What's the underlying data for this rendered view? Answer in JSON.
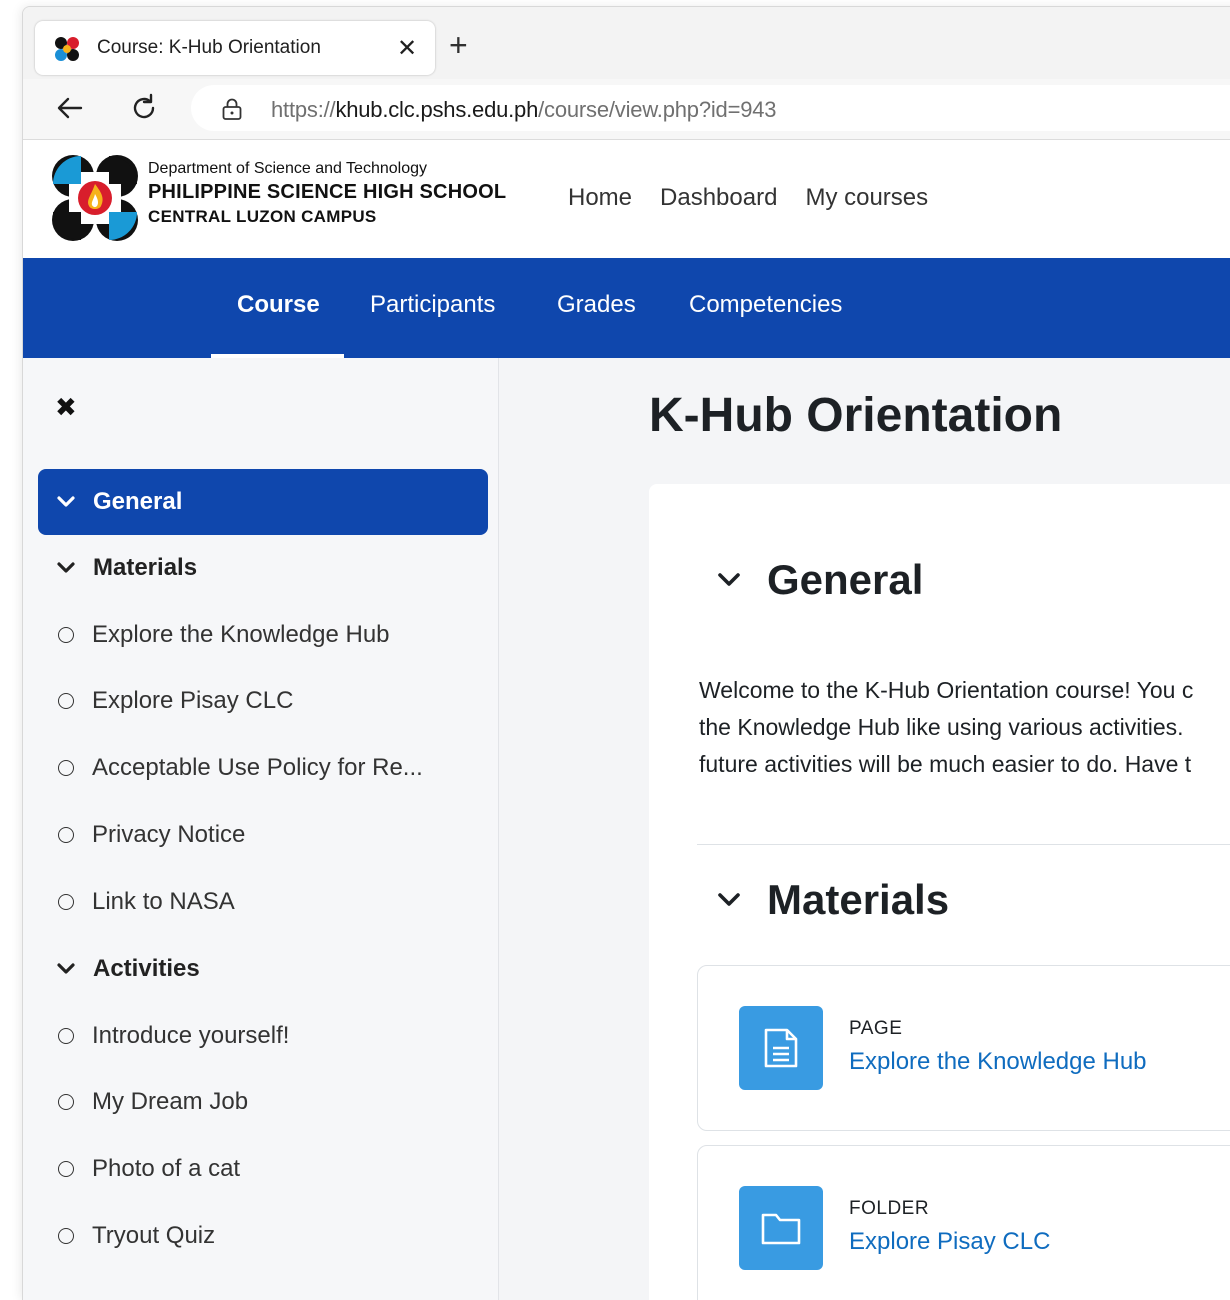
{
  "browser": {
    "tab_title": "Course: K-Hub Orientation",
    "tab_close": "✕",
    "new_tab": "+",
    "url_prefix": "https://",
    "url_host": "khub.clc.pshs.edu.ph",
    "url_path": "/course/view.php?id=943"
  },
  "site": {
    "logo_line1": "Department of Science and Technology",
    "logo_line2": "PHILIPPINE SCIENCE HIGH SCHOOL",
    "logo_line3": "CENTRAL LUZON CAMPUS",
    "topnav": [
      "Home",
      "Dashboard",
      "My courses"
    ]
  },
  "course_nav": {
    "items": [
      "Course",
      "Participants",
      "Grades",
      "Competencies"
    ],
    "active": "Course"
  },
  "sidebar": {
    "close_symbol": "✖",
    "items": [
      {
        "label": "General",
        "kind": "section",
        "active": true
      },
      {
        "label": "Materials",
        "kind": "section",
        "active": false
      },
      {
        "label": "Explore the Knowledge Hub",
        "kind": "activity"
      },
      {
        "label": "Explore Pisay CLC",
        "kind": "activity"
      },
      {
        "label": "Acceptable Use Policy for Re...",
        "kind": "activity"
      },
      {
        "label": "Privacy Notice",
        "kind": "activity"
      },
      {
        "label": "Link to NASA",
        "kind": "activity"
      },
      {
        "label": "Activities",
        "kind": "section",
        "active": false
      },
      {
        "label": "Introduce yourself!",
        "kind": "activity"
      },
      {
        "label": "My Dream Job",
        "kind": "activity"
      },
      {
        "label": "Photo of a cat",
        "kind": "activity"
      },
      {
        "label": "Tryout Quiz",
        "kind": "activity"
      }
    ]
  },
  "main": {
    "title": "K-Hub Orientation",
    "sections": [
      {
        "title": "General",
        "summary_lines": [
          "Welcome to the K-Hub Orientation course! You c",
          "the Knowledge Hub like using various activities.",
          "future activities will be much easier to do. Have t"
        ]
      },
      {
        "title": "Materials",
        "activities": [
          {
            "type": "PAGE",
            "name": "Explore the Knowledge Hub",
            "icon": "page-icon"
          },
          {
            "type": "FOLDER",
            "name": "Explore Pisay CLC",
            "icon": "folder-icon"
          }
        ]
      }
    ]
  },
  "colors": {
    "brand_blue": "#0f47ad",
    "link_blue": "#0f6cbf",
    "activity_icon_bg": "#399be2"
  }
}
